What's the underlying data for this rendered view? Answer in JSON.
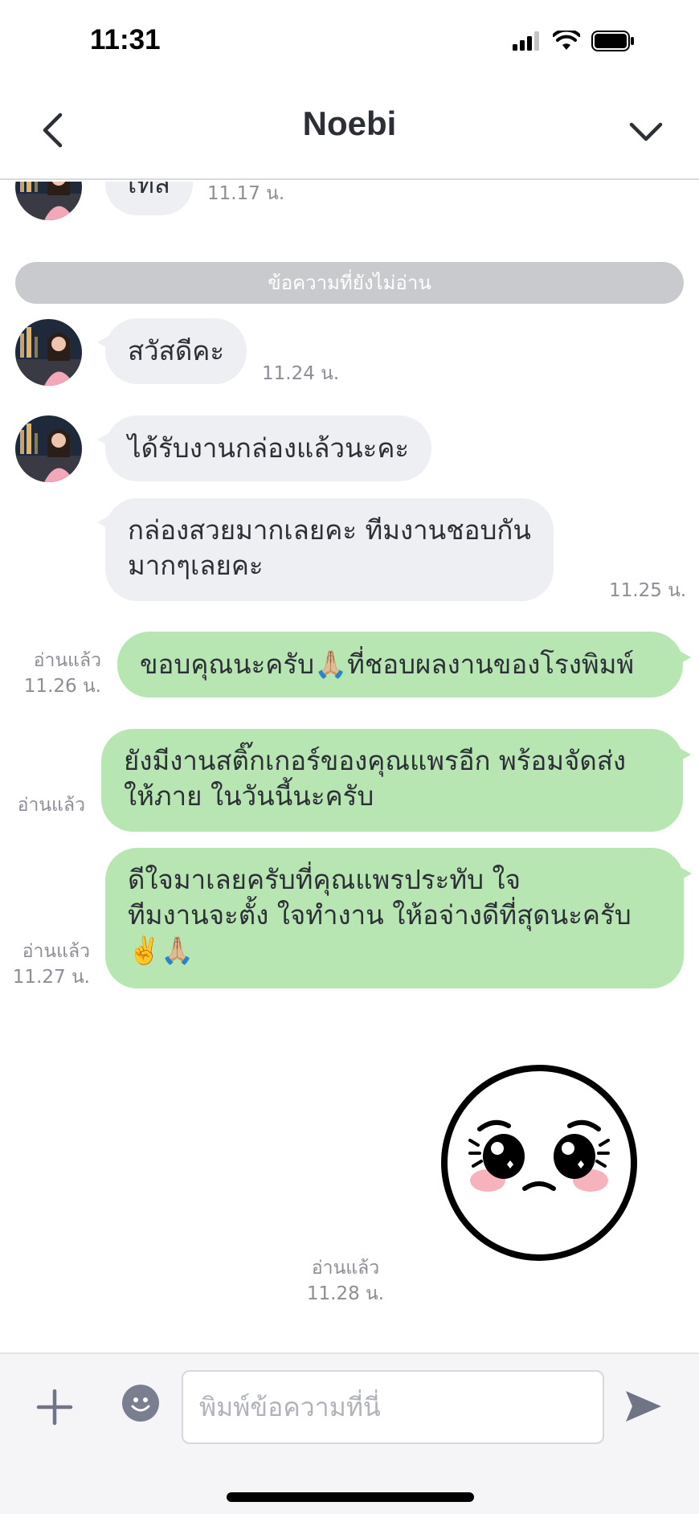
{
  "status_bar": {
    "time": "11:31"
  },
  "header": {
    "title": "Noebi"
  },
  "divider": {
    "label": "ข้อความที่ยังไม่อ่าน"
  },
  "messages": [
    {
      "side": "in",
      "text": "เทส",
      "time": "11.17 น."
    },
    {
      "side": "in",
      "text": "สวัสดีคะ",
      "time": "11.24 น."
    },
    {
      "side": "in",
      "text": "ได้รับงานกล่องแล้วนะคะ"
    },
    {
      "side": "in",
      "lines": [
        "กล่องสวยมากเลยคะ ทีมงานชอบกัน",
        "มากๆเลยคะ"
      ],
      "time": "11.25 น."
    },
    {
      "side": "out",
      "text": "ขอบคุณนะครับ🙏🏼ที่ชอบผลงานของโรงพิมพ์",
      "read": "อ่านแล้ว",
      "time": "11.26 น."
    },
    {
      "side": "out",
      "lines": [
        "ยังมีงานสติ๊กเกอร์ของคุณแพรอีก พร้อมจัดส่ง",
        "ให้ภาย ในวันนี้นะครับ"
      ],
      "read": "อ่านแล้ว"
    },
    {
      "side": "out",
      "lines": [
        "ดีใจมาเลยครับที่คุณแพรประทับ ใจ",
        "ทีมงานจะตั้ง ใจทำงาน ให้อจ่างดีที่สุดนะครับ",
        "✌️🙏🏼"
      ],
      "read": "อ่านแล้ว",
      "time": "11.27 น."
    },
    {
      "side": "out",
      "sticker": "crying-face-sticker",
      "read": "อ่านแล้ว",
      "time": "11.28 น."
    }
  ],
  "composer": {
    "placeholder": "พิมพ์ข้อความที่นี่"
  },
  "icons": {
    "back": "chevron-left-icon",
    "menu": "chevron-down-icon",
    "plus": "plus-icon",
    "emoji": "emoji-icon",
    "send": "send-icon"
  },
  "colors": {
    "incoming_bubble": "#eeeff3",
    "outgoing_bubble": "#b8e6b3",
    "divider": "#c9cacd",
    "text": "#2d2f36",
    "meta": "#8b8e96"
  }
}
